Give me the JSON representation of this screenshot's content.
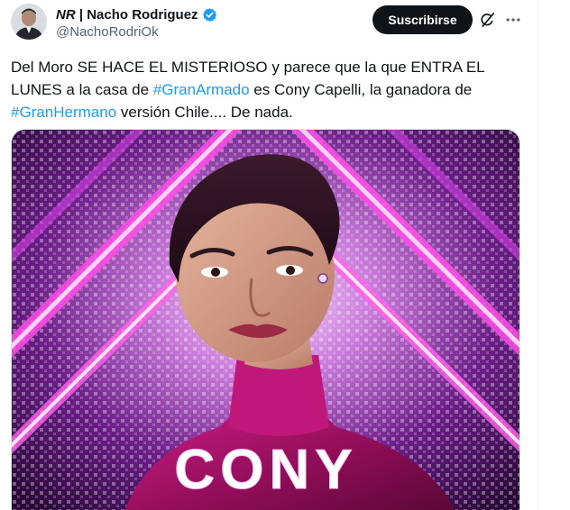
{
  "author": {
    "display_name_prefix": "NR",
    "display_name_sep": " | ",
    "display_name": "Nacho Rodriguez",
    "handle": "@NachoRodriOk",
    "verified": true
  },
  "actions": {
    "subscribe_label": "Suscribirse",
    "grok_icon": "grok-icon",
    "more_icon": "more-options-icon"
  },
  "tweet": {
    "text_1": "Del Moro SE HACE EL MISTERIOSO y parece que la que ENTRA EL LUNES a la casa de ",
    "hashtag_1": "#GranArmado",
    "text_2": " es Cony Capelli, la ganadora de ",
    "hashtag_2": "#GranHermano",
    "text_3": " versión Chile.... De nada."
  },
  "media": {
    "caption_text": "CONY"
  },
  "colors": {
    "accent": "#1d9bf0",
    "button_bg": "#0f1419",
    "muted_text": "#536471",
    "verified": "#1d9bf0",
    "media_magenta": "#e23bd8",
    "media_purple": "#5a1470"
  }
}
